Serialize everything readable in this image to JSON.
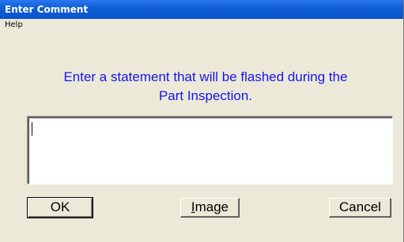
{
  "window": {
    "title": "Enter Comment"
  },
  "menu": {
    "items": [
      {
        "label": "Help"
      }
    ]
  },
  "prompt": {
    "line1": "Enter a statement that will be flashed during the",
    "line2": "Part Inspection."
  },
  "comment_input": {
    "value": ""
  },
  "buttons": {
    "ok": "OK",
    "image_first": "I",
    "image_rest": "mage",
    "cancel": "Cancel"
  },
  "colors": {
    "prompt_text": "#1515ee",
    "title_bar": "#0953cc",
    "dialog_bg": "#ece9d8"
  }
}
